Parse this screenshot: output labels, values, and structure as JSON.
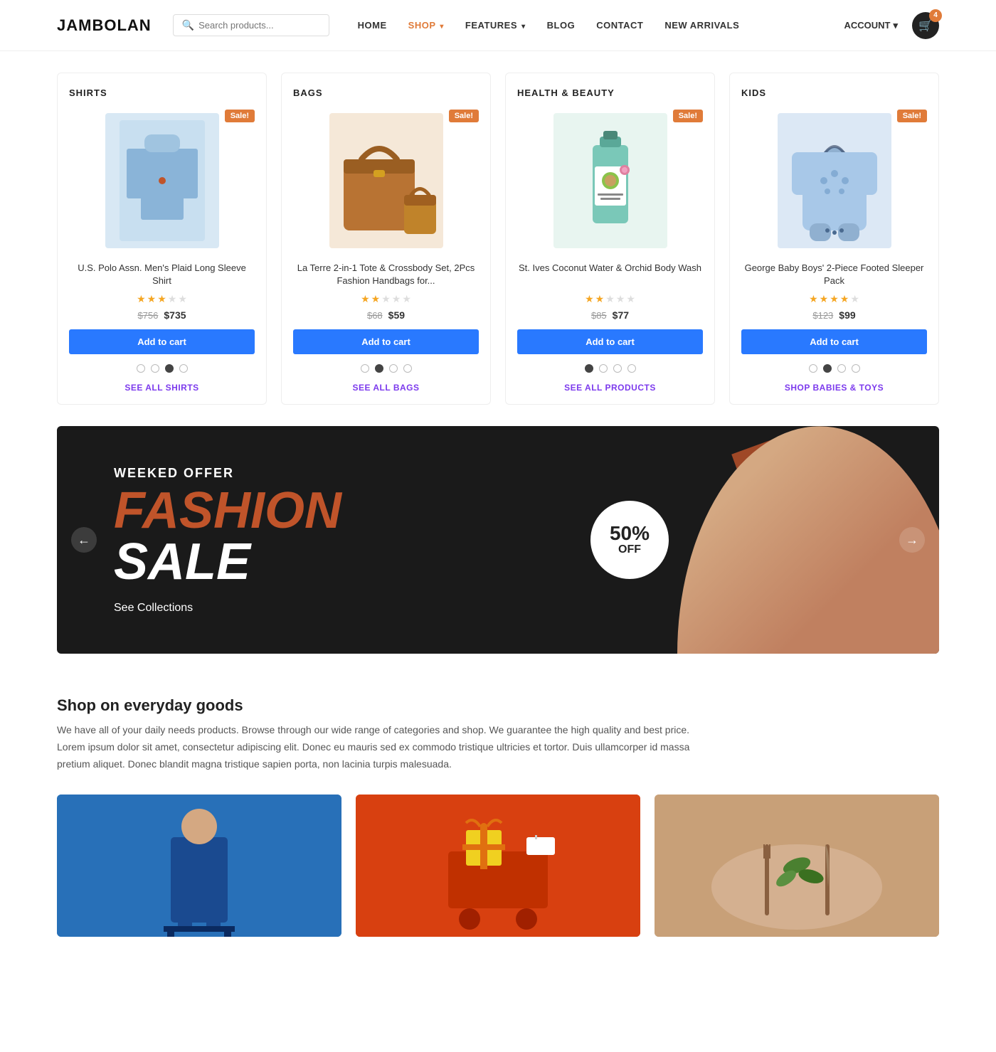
{
  "header": {
    "logo": "JAMBOLAN",
    "search_placeholder": "Search products...",
    "nav": [
      {
        "label": "HOME",
        "href": "#",
        "class": ""
      },
      {
        "label": "SHOP",
        "href": "#",
        "class": "shop",
        "has_caret": true
      },
      {
        "label": "FEATURES",
        "href": "#",
        "class": "",
        "has_caret": true
      },
      {
        "label": "BLOG",
        "href": "#",
        "class": ""
      },
      {
        "label": "CONTACT",
        "href": "#",
        "class": ""
      },
      {
        "label": "NEW ARRIVALS",
        "href": "#",
        "class": ""
      }
    ],
    "account_label": "ACCOUNT",
    "cart_count": "4"
  },
  "categories": [
    {
      "id": "shirts",
      "title": "SHIRTS",
      "sale_label": "Sale!",
      "product_name": "U.S. Polo Assn. Men's Plaid Long Sleeve Shirt",
      "stars": 3,
      "price_original": "$756",
      "price_sale": "$735",
      "add_to_cart": "Add to cart",
      "dots": [
        false,
        false,
        true,
        false
      ],
      "see_all": "SEE ALL SHIRTS"
    },
    {
      "id": "bags",
      "title": "BAGS",
      "sale_label": "Sale!",
      "product_name": "La Terre 2-in-1 Tote & Crossbody Set, 2Pcs Fashion Handbags for...",
      "stars": 2,
      "price_original": "$68",
      "price_sale": "$59",
      "add_to_cart": "Add to cart",
      "dots": [
        false,
        true,
        false,
        false
      ],
      "see_all": "SEE ALL BAGS"
    },
    {
      "id": "health",
      "title": "HEALTH & BEAUTY",
      "sale_label": "Sale!",
      "product_name": "St. Ives Coconut Water & Orchid Body Wash",
      "stars": 2,
      "price_original": "$85",
      "price_sale": "$77",
      "add_to_cart": "Add to cart",
      "dots": [
        true,
        false,
        false,
        false
      ],
      "see_all": "SEE ALL PRODUCTS"
    },
    {
      "id": "kids",
      "title": "KIDS",
      "sale_label": "Sale!",
      "product_name": "George Baby Boys' 2-Piece Footed Sleeper Pack",
      "stars": 4,
      "price_original": "$123",
      "price_sale": "$99",
      "add_to_cart": "Add to cart",
      "dots": [
        false,
        true,
        false,
        false
      ],
      "see_all": "SHOP BABIES & TOYS"
    }
  ],
  "banner": {
    "subtitle": "WEEKED OFFER",
    "title_fashion": "FASHION",
    "title_sale": "SALE",
    "discount_pct": "50%",
    "discount_off": "OFF",
    "cta_label": "See Collections"
  },
  "shop_section": {
    "title": "Shop on everyday goods",
    "description": "We have all of your daily needs products. Browse through our wide range of categories and shop. We guarantee the high quality and best price. Lorem ipsum dolor sit amet, consectetur adipiscing elit. Donec eu mauris sed ex commodo tristique ultricies et tortor. Duis ullamcorper id massa pretium aliquet. Donec blandit magna tristique sapien porta, non lacinia turpis malesuada."
  }
}
